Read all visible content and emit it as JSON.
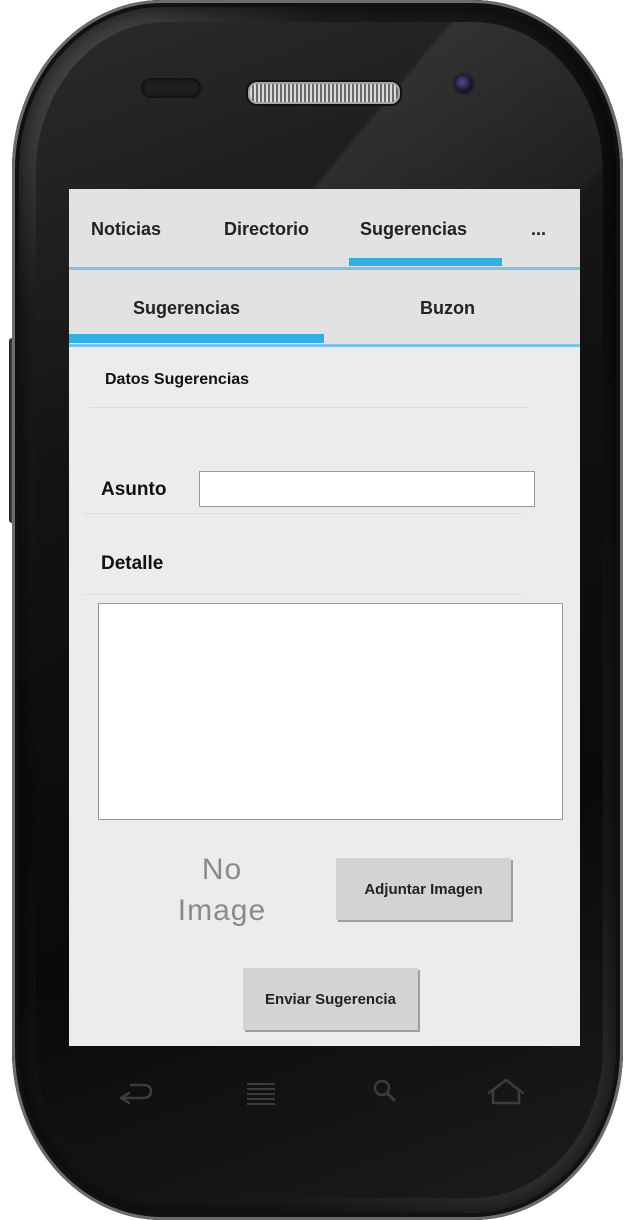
{
  "tabs": [
    {
      "label": "Noticias"
    },
    {
      "label": "Directorio"
    },
    {
      "label": "Sugerencias"
    },
    {
      "label": "..."
    }
  ],
  "active_tab": "Sugerencias",
  "subtabs": [
    {
      "label": "Sugerencias"
    },
    {
      "label": "Buzon"
    }
  ],
  "active_subtab": "Sugerencias",
  "form": {
    "section_title": "Datos Sugerencias",
    "asunto_label": "Asunto",
    "asunto_value": "",
    "detalle_label": "Detalle",
    "detalle_value": "",
    "no_image_line1": "No",
    "no_image_line2": "Image",
    "attach_button": "Adjuntar Imagen",
    "submit_button": "Enviar Sugerencia"
  },
  "navbar": {
    "icons": [
      "back-icon",
      "menu-icon",
      "search-icon",
      "home-icon"
    ]
  },
  "colors": {
    "accent": "#31aee4",
    "screen_bg": "#ececec",
    "tab_bg": "#e2e2e2",
    "button_bg": "#d3d3d3"
  }
}
